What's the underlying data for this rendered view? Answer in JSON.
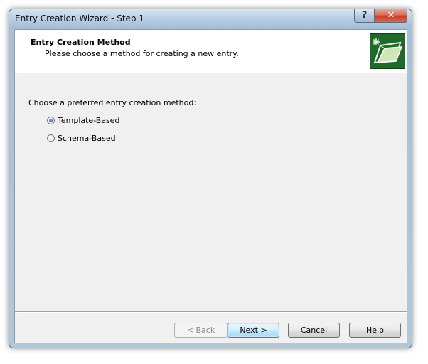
{
  "window": {
    "title": "Entry Creation Wizard - Step 1",
    "help_glyph": "?",
    "close_glyph": "✕"
  },
  "header": {
    "title": "Entry Creation Method",
    "subtitle": "Please choose a method for creating a new entry.",
    "logo_icon": "wizard-folder-icon"
  },
  "body": {
    "prompt": "Choose a preferred entry creation method:",
    "options": [
      {
        "label": "Template-Based",
        "checked": true
      },
      {
        "label": "Schema-Based",
        "checked": false
      }
    ]
  },
  "buttons": {
    "back": "< Back",
    "next": "Next >",
    "cancel": "Cancel",
    "help": "Help"
  },
  "colors": {
    "logo_background": "#1d6a2a",
    "default_button_border": "#3c7fb1"
  }
}
